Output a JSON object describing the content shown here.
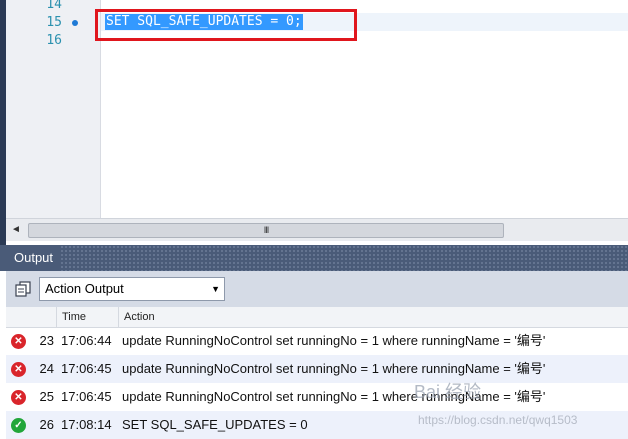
{
  "editor": {
    "lines": [
      {
        "number": "14",
        "text": ""
      },
      {
        "number": "15",
        "text": "SET SQL_SAFE_UPDATES = 0;"
      },
      {
        "number": "16",
        "text": ""
      }
    ]
  },
  "scrollbar": {
    "left_arrow": "◄",
    "thumb_grip": "III"
  },
  "output": {
    "title": "Output",
    "dropdown_value": "Action Output",
    "columns": [
      "Time",
      "Action"
    ],
    "rows": [
      {
        "status": "error",
        "num": "23",
        "time": "17:06:44",
        "action": "update RunningNoControl set runningNo = 1 where runningName = '编号'"
      },
      {
        "status": "error",
        "num": "24",
        "time": "17:06:45",
        "action": "update RunningNoControl set runningNo = 1 where runningName = '编号'"
      },
      {
        "status": "error",
        "num": "25",
        "time": "17:06:45",
        "action": "update RunningNoControl set runningNo = 1 where runningName = '编号'"
      },
      {
        "status": "success",
        "num": "26",
        "time": "17:08:14",
        "action": "SET SQL_SAFE_UPDATES = 0"
      }
    ]
  },
  "watermark": {
    "logo": "Bai 经验",
    "url": "https://blog.csdn.net/qwq1503"
  },
  "colors": {
    "selection": "#3399ff",
    "highlight_box": "#e0161d",
    "panel_header": "#4a5b78",
    "error": "#d9252b",
    "success": "#22a63a"
  }
}
